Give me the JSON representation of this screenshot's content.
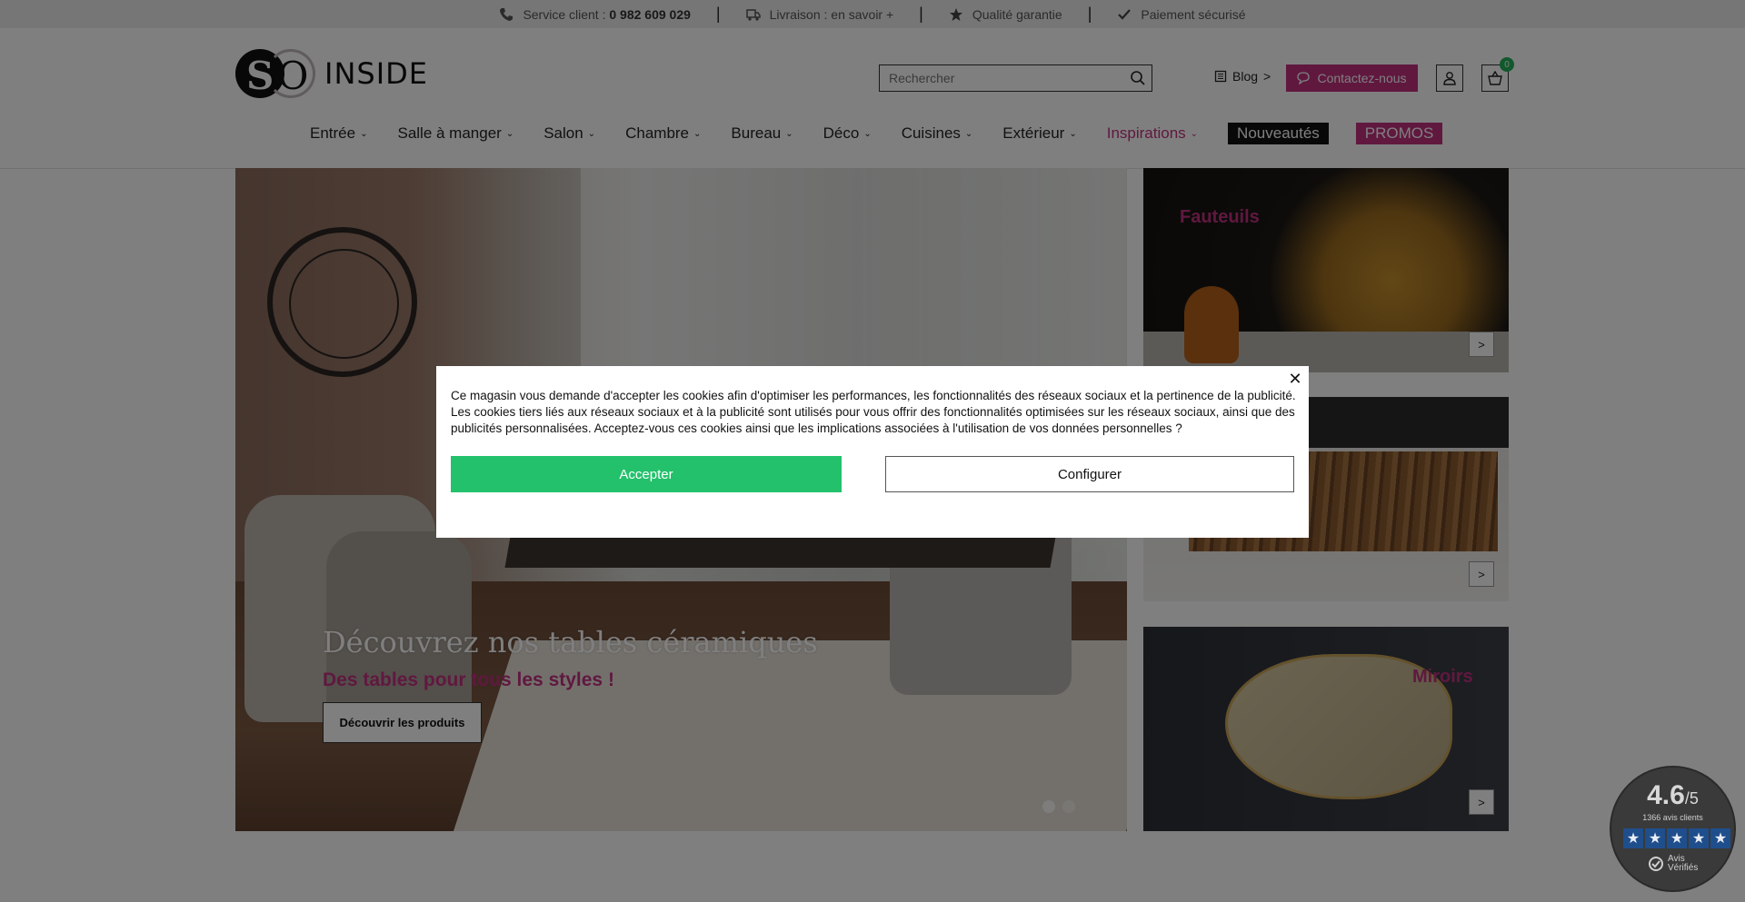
{
  "topbar": {
    "service_label": "Service client : ",
    "service_phone": "0 982 609 029",
    "delivery": "Livraison : en savoir +",
    "quality": "Qualité garantie",
    "payment": "Paiement sécurisé",
    "separator": "|"
  },
  "header": {
    "logo_text": "INSIDE",
    "logo_s": "S",
    "logo_o": "O",
    "search_placeholder": "Rechercher",
    "blog": "Blog",
    "blog_chevron": ">",
    "contact": "Contactez-nous",
    "cart_count": "0"
  },
  "nav": {
    "items": [
      {
        "label": "Entrée"
      },
      {
        "label": "Salle à manger"
      },
      {
        "label": "Salon"
      },
      {
        "label": "Chambre"
      },
      {
        "label": "Bureau"
      },
      {
        "label": "Déco"
      },
      {
        "label": "Cuisines"
      },
      {
        "label": "Extérieur"
      },
      {
        "label": "Inspirations"
      }
    ],
    "chevron": "⌄",
    "new": "Nouveautés",
    "promos": "PROMOS"
  },
  "hero": {
    "title": "Découvrez nos tables céramiques",
    "subtitle": "Des tables pour tous les styles !",
    "button": "Découvrir les produits"
  },
  "cards": {
    "fauteuils": "Fauteuils",
    "miroirs": "Miroirs",
    "cta": ">"
  },
  "cookie": {
    "text": "Ce magasin vous demande d'accepter les cookies afin d'optimiser les performances, les fonctionnalités des réseaux sociaux et la pertinence de la publicité. Les cookies tiers liés aux réseaux sociaux et à la publicité sont utilisés pour vous offrir des fonctionnalités optimisées sur les réseaux sociaux, ainsi que des publicités personnalisées. Acceptez-vous ces cookies ainsi que les implications associées à l'utilisation de vos données personnelles ?",
    "accept": "Accepter",
    "configure": "Configurer",
    "close": "✕"
  },
  "rating": {
    "score": "4.6",
    "max": "/5",
    "count": "1366 avis clients",
    "star": "★",
    "verified_line1": "Avis",
    "verified_line2": "Vérifiés"
  },
  "colors": {
    "brand_pink": "#c0317f",
    "accept_green": "#23c16b",
    "cart_badge": "#23b25a",
    "star_blue": "#1f4e8c"
  }
}
